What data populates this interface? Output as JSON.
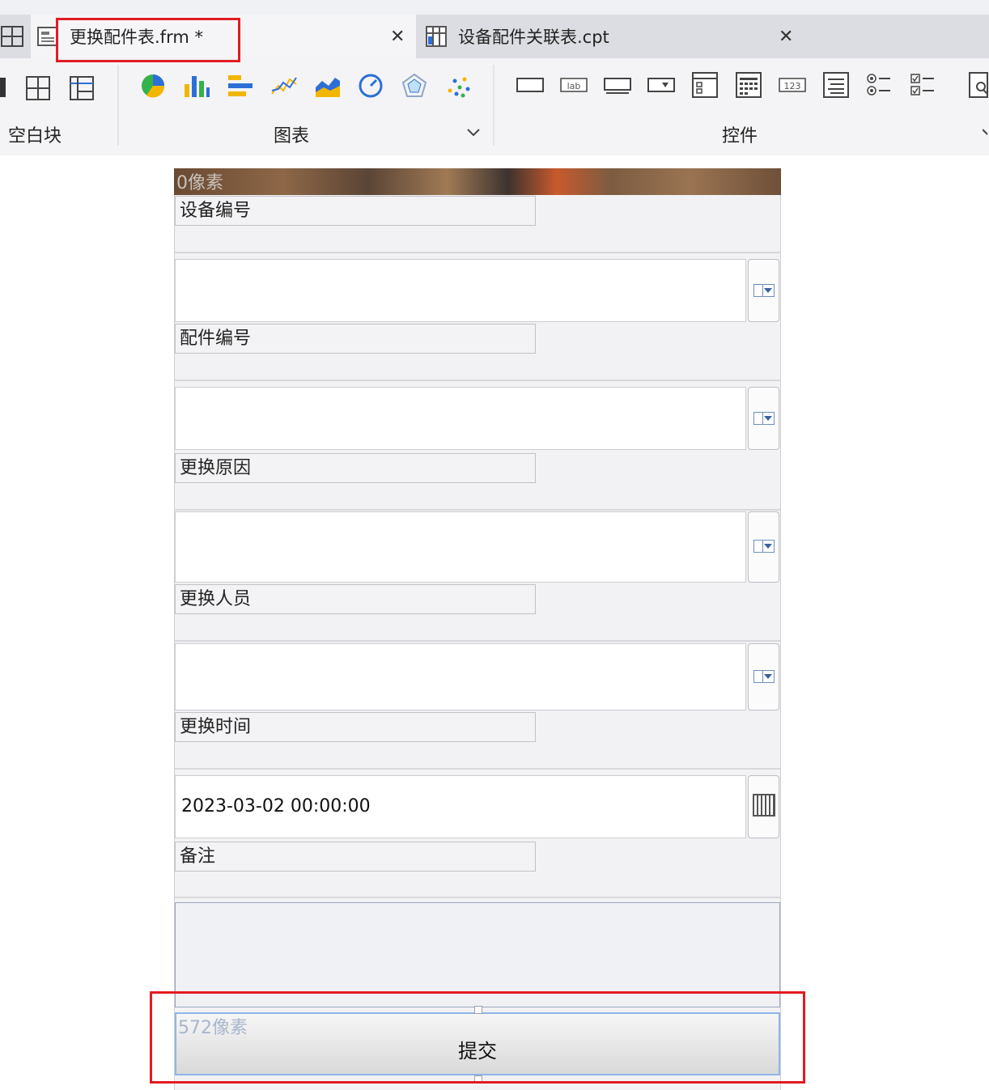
{
  "tabs": [
    {
      "label": "更换配件表.frm *",
      "active": true
    },
    {
      "label": "设备配件关联表.cpt",
      "active": false
    }
  ],
  "ribbon": {
    "groups": [
      {
        "label": "空白块"
      },
      {
        "label": "图表"
      },
      {
        "label": "控件"
      }
    ]
  },
  "form": {
    "top_pixel_label": "0像素",
    "bottom_pixel_label": "572像素",
    "fields": [
      {
        "label": "设备编号",
        "value": "",
        "widget": "dropdown"
      },
      {
        "label": "配件编号",
        "value": "",
        "widget": "dropdown"
      },
      {
        "label": "更换原因",
        "value": "",
        "widget": "dropdown"
      },
      {
        "label": "更换人员",
        "value": "",
        "widget": "dropdown"
      },
      {
        "label": "更换时间",
        "value": "2023-03-02 00:00:00",
        "widget": "date"
      }
    ],
    "remark_label": "备注",
    "submit_label": "提交"
  },
  "colors": {
    "highlight": "#e31b23",
    "accent_blue": "#3b78e7",
    "selection_border": "#8fb6e6"
  }
}
